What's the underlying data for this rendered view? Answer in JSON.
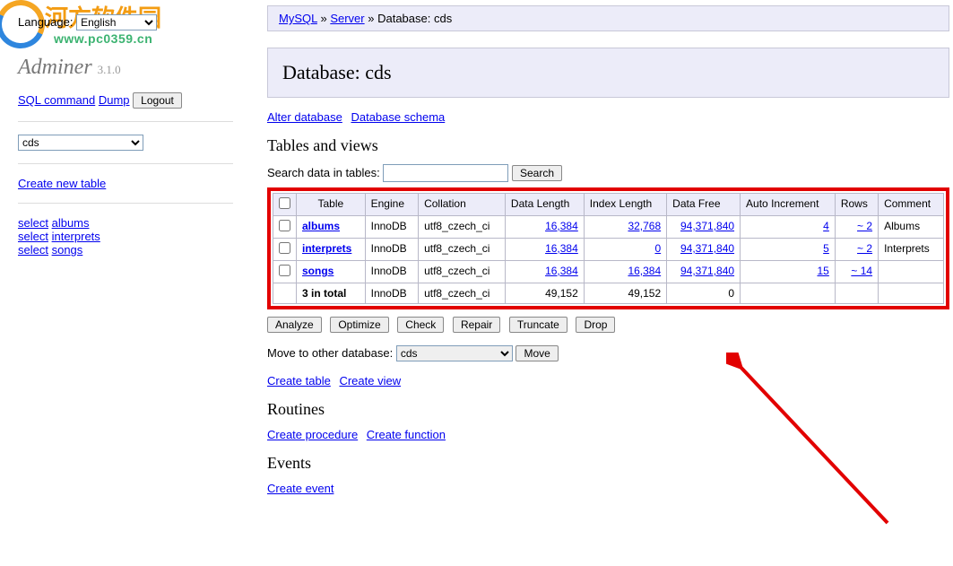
{
  "lang": {
    "label": "Language:",
    "value": "English"
  },
  "watermark": {
    "cn": "河方软件园",
    "url": "www.pc0359.cn"
  },
  "brand": {
    "name": "Adminer",
    "version": "3.1.0"
  },
  "sidebar": {
    "sql_command": "SQL command",
    "dump": "Dump",
    "logout": "Logout",
    "db_selected": "cds",
    "create_table": "Create new table",
    "select": "select",
    "items": [
      "albums",
      "interprets",
      "songs"
    ]
  },
  "breadcrumb": {
    "mysql": "MySQL",
    "server": "Server",
    "db_label": "Database: ",
    "db": "cds",
    "sep": " » "
  },
  "heading": "Database: cds",
  "links": {
    "alter_db": "Alter database",
    "db_schema": "Database schema"
  },
  "tables_heading": "Tables and views",
  "search": {
    "label": "Search data in tables:",
    "button": "Search",
    "value": ""
  },
  "headers": {
    "table": "Table",
    "engine": "Engine",
    "collation": "Collation",
    "data_len": "Data Length",
    "index_len": "Index Length",
    "data_free": "Data Free",
    "auto_inc": "Auto Increment",
    "rows": "Rows",
    "comment": "Comment"
  },
  "rows": [
    {
      "table": "albums",
      "engine": "InnoDB",
      "collation": "utf8_czech_ci",
      "data_len": "16,384",
      "index_len": "32,768",
      "data_free": "94,371,840",
      "auto_inc": "4",
      "rows": "~ 2",
      "comment": "Albums"
    },
    {
      "table": "interprets",
      "engine": "InnoDB",
      "collation": "utf8_czech_ci",
      "data_len": "16,384",
      "index_len": "0",
      "data_free": "94,371,840",
      "auto_inc": "5",
      "rows": "~ 2",
      "comment": "Interprets"
    },
    {
      "table": "songs",
      "engine": "InnoDB",
      "collation": "utf8_czech_ci",
      "data_len": "16,384",
      "index_len": "16,384",
      "data_free": "94,371,840",
      "auto_inc": "15",
      "rows": "~ 14",
      "comment": ""
    }
  ],
  "total": {
    "label": "3 in total",
    "engine": "InnoDB",
    "collation": "utf8_czech_ci",
    "data_len": "49,152",
    "index_len": "49,152",
    "data_free": "0",
    "auto_inc": "",
    "rows": "",
    "comment": ""
  },
  "actions": {
    "analyze": "Analyze",
    "optimize": "Optimize",
    "check": "Check",
    "repair": "Repair",
    "truncate": "Truncate",
    "drop": "Drop"
  },
  "move": {
    "label": "Move to other database:",
    "selected": "cds",
    "button": "Move"
  },
  "create_links": {
    "table": "Create table",
    "view": "Create view"
  },
  "routines": {
    "heading": "Routines",
    "procedure": "Create procedure",
    "function": "Create function"
  },
  "events": {
    "heading": "Events",
    "create": "Create event"
  }
}
